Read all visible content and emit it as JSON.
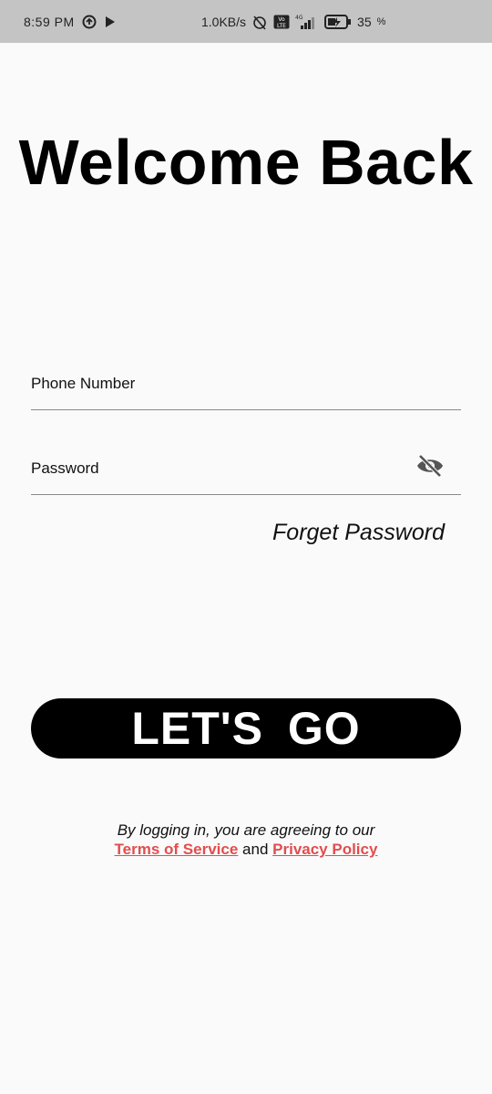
{
  "status_bar": {
    "time": "8:59 PM",
    "network_speed": "1.0KB/s",
    "network_type": "4G",
    "volte": "Vo LTE",
    "battery_percent": "35",
    "battery_unit": "%",
    "icons": [
      "data-saver-icon",
      "play-store-icon",
      "mute-alarm-icon",
      "volte-icon",
      "signal-icon",
      "battery-charging-icon"
    ]
  },
  "page": {
    "title": "Welcome Back",
    "phone_label": "Phone Number",
    "password_label": "Password",
    "forget_password": "Forget Password",
    "cta_label": "LET'S GO",
    "legal_prefix": "By logging in, you are agreeing to our",
    "terms_link": "Terms of Service",
    "legal_and": "and",
    "privacy_link": "Privacy Policy"
  },
  "colors": {
    "background": "#fafafa",
    "status_bar": "#c4c4c4",
    "button": "#000000",
    "link": "#e34d4d"
  }
}
